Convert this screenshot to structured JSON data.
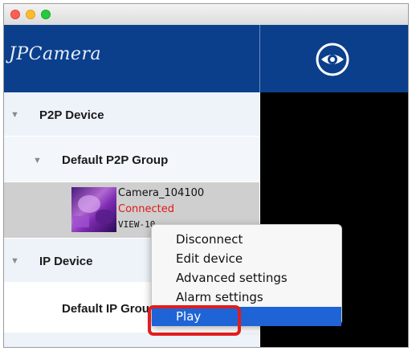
{
  "app": {
    "logo_text": "JPCamera",
    "colors": {
      "header": "#0b3f8c",
      "accent_highlight": "#1e64d6",
      "status_connected": "#e01818",
      "annotation": "#e11d1d"
    }
  },
  "toolbar": {
    "view_icon": "eye-icon"
  },
  "sidebar": {
    "p2p_device": {
      "label": "P2P Device",
      "icon": "triangle-down-icon"
    },
    "default_p2p_group": {
      "label": "Default P2P Group",
      "icon": "triangle-down-icon"
    },
    "camera": {
      "name": "Camera_104100",
      "status": "Connected",
      "view": "VIEW-10",
      "thumbnail": "camera-thumbnail"
    },
    "ip_device": {
      "label": "IP Device",
      "icon": "triangle-down-icon"
    },
    "default_ip_group": {
      "label": "Default IP Group"
    }
  },
  "context_menu": {
    "items": [
      {
        "label": "Disconnect"
      },
      {
        "label": "Edit device"
      },
      {
        "label": "Advanced settings"
      },
      {
        "label": "Alarm settings"
      },
      {
        "label": "Play",
        "selected": true
      }
    ]
  }
}
